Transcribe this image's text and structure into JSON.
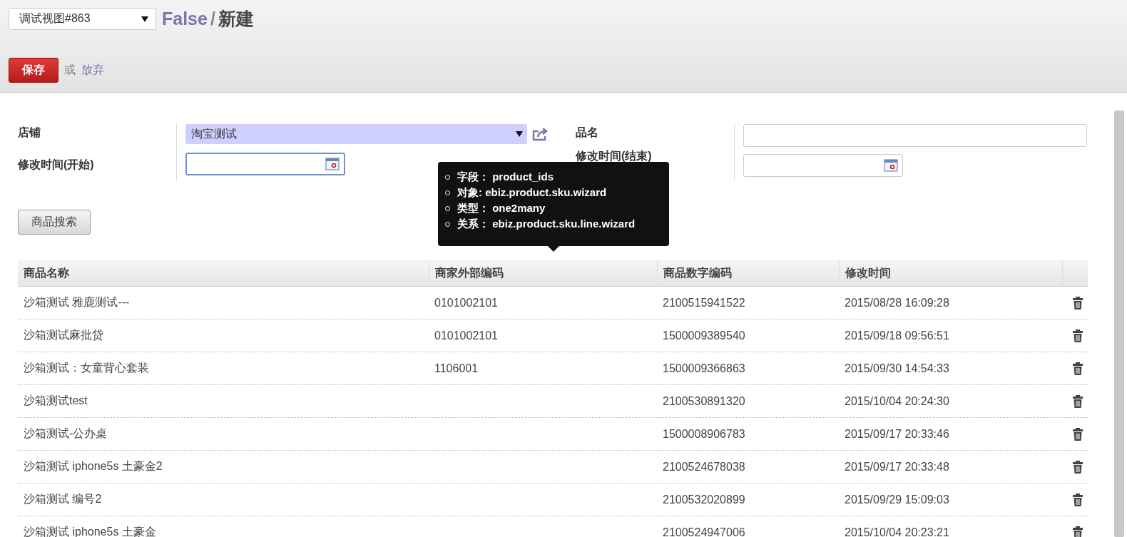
{
  "view_select": {
    "value": "调试视图#863"
  },
  "breadcrumb": {
    "record": "False",
    "separator": "/",
    "current": "新建"
  },
  "actions": {
    "save": "保存",
    "or": "或",
    "discard": "放弃"
  },
  "form": {
    "store_label": "店铺",
    "store_value": "淘宝测试",
    "name_label": "品名",
    "start_label": "修改时间(开始)",
    "end_label": "修改时间(结束)",
    "search_button": "商品搜索"
  },
  "tooltip": {
    "items": [
      {
        "label": "字段：",
        "value": "product_ids"
      },
      {
        "label": "对象:",
        "value": "ebiz.product.sku.wizard"
      },
      {
        "label": "类型：",
        "value": "one2many"
      },
      {
        "label": "关系：",
        "value": "ebiz.product.sku.line.wizard"
      }
    ]
  },
  "table": {
    "columns": [
      "商品名称",
      "商家外部编码",
      "商品数字编码",
      "修改时间"
    ],
    "rows": [
      {
        "name": "沙箱测试 雅鹿测试---",
        "external_code": "0101002101",
        "digital_code": "2100515941522",
        "modified": "2015/08/28 16:09:28"
      },
      {
        "name": "沙箱测试麻批贷",
        "external_code": "0101002101",
        "digital_code": "1500009389540",
        "modified": "2015/09/18 09:56:51"
      },
      {
        "name": "沙箱测试：女童背心套装",
        "external_code": "1106001",
        "digital_code": "1500009366863",
        "modified": "2015/09/30 14:54:33"
      },
      {
        "name": "沙箱测试test",
        "digital_code": "2100530891320",
        "modified": "2015/10/04 20:24:30"
      },
      {
        "name": "沙箱测试-公办桌",
        "digital_code": "1500008906783",
        "modified": "2015/09/17 20:33:46"
      },
      {
        "name": "沙箱测试 iphone5s 土豪金2",
        "digital_code": "2100524678038",
        "modified": "2015/09/17 20:33:48"
      },
      {
        "name": "沙箱测试 编号2",
        "digital_code": "2100532020899",
        "modified": "2015/09/29 15:09:03"
      },
      {
        "name": "沙箱测试 iphone5s 土豪金",
        "digital_code": "2100524947006",
        "modified": "2015/10/04 20:23:21"
      }
    ]
  }
}
